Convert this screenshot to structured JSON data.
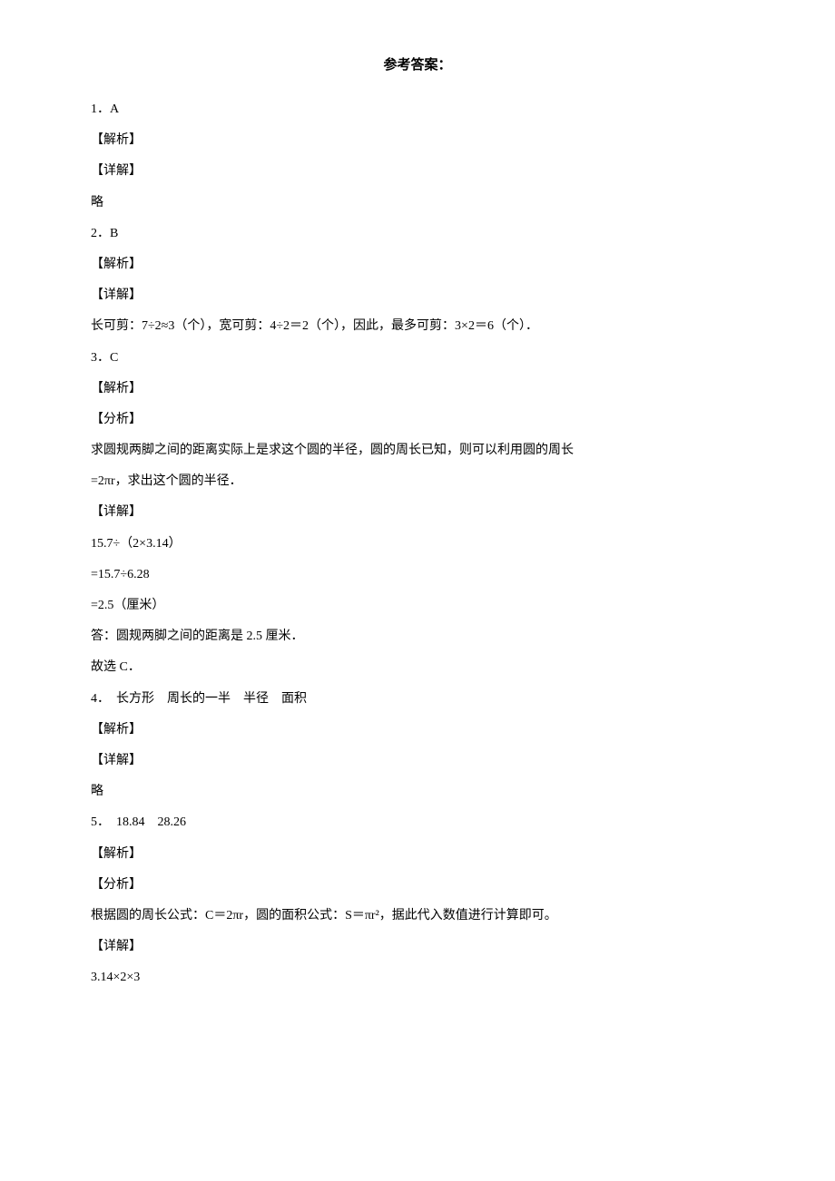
{
  "title": "参考答案：",
  "lines": [
    "1．A",
    "【解析】",
    "【详解】",
    "略",
    "2．B",
    "【解析】",
    "【详解】",
    "长可剪：7÷2≈3（个），宽可剪：4÷2＝2（个），因此，最多可剪：3×2＝6（个）．",
    "3．C",
    "【解析】",
    "【分析】",
    "求圆规两脚之间的距离实际上是求这个圆的半径，圆的周长已知，则可以利用圆的周长",
    "=2πr，求出这个圆的半径．",
    "【详解】",
    "15.7÷（2×3.14）",
    "=15.7÷6.28",
    "=2.5（厘米）",
    "答：圆规两脚之间的距离是 2.5 厘米．",
    "故选 C．",
    "4．　长方形　周长的一半　半径　面积",
    "【解析】",
    "【详解】",
    "略",
    "5．　18.84　28.26",
    "【解析】",
    "【分析】",
    "根据圆的周长公式：C＝2πr，圆的面积公式：S＝πr²，据此代入数值进行计算即可。",
    "【详解】",
    "3.14×2×3"
  ]
}
